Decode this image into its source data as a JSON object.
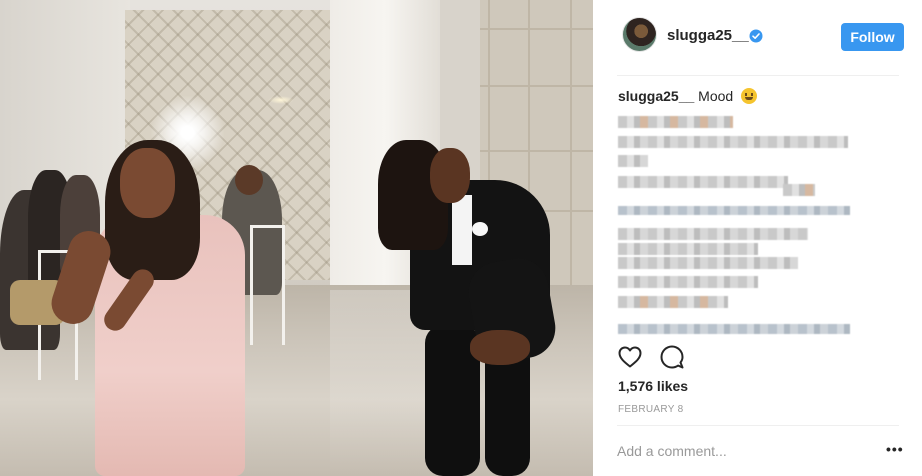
{
  "post": {
    "username": "slugga25__",
    "follow_label": "Follow",
    "caption_user": "slugga25__",
    "caption_text": "Mood",
    "caption_emoji": "smiling-face",
    "likes": "1,576 likes",
    "date": "FEBRUARY 8",
    "comment_placeholder": "Add a comment...",
    "more_label": "•••"
  },
  "icons": {
    "verified": "verified-badge-icon",
    "like": "heart-icon",
    "comment": "speech-bubble-icon"
  },
  "colors": {
    "follow_button": "#3897f0",
    "verified_badge": "#3897f0",
    "text_primary": "#262626",
    "text_secondary": "#999999"
  }
}
